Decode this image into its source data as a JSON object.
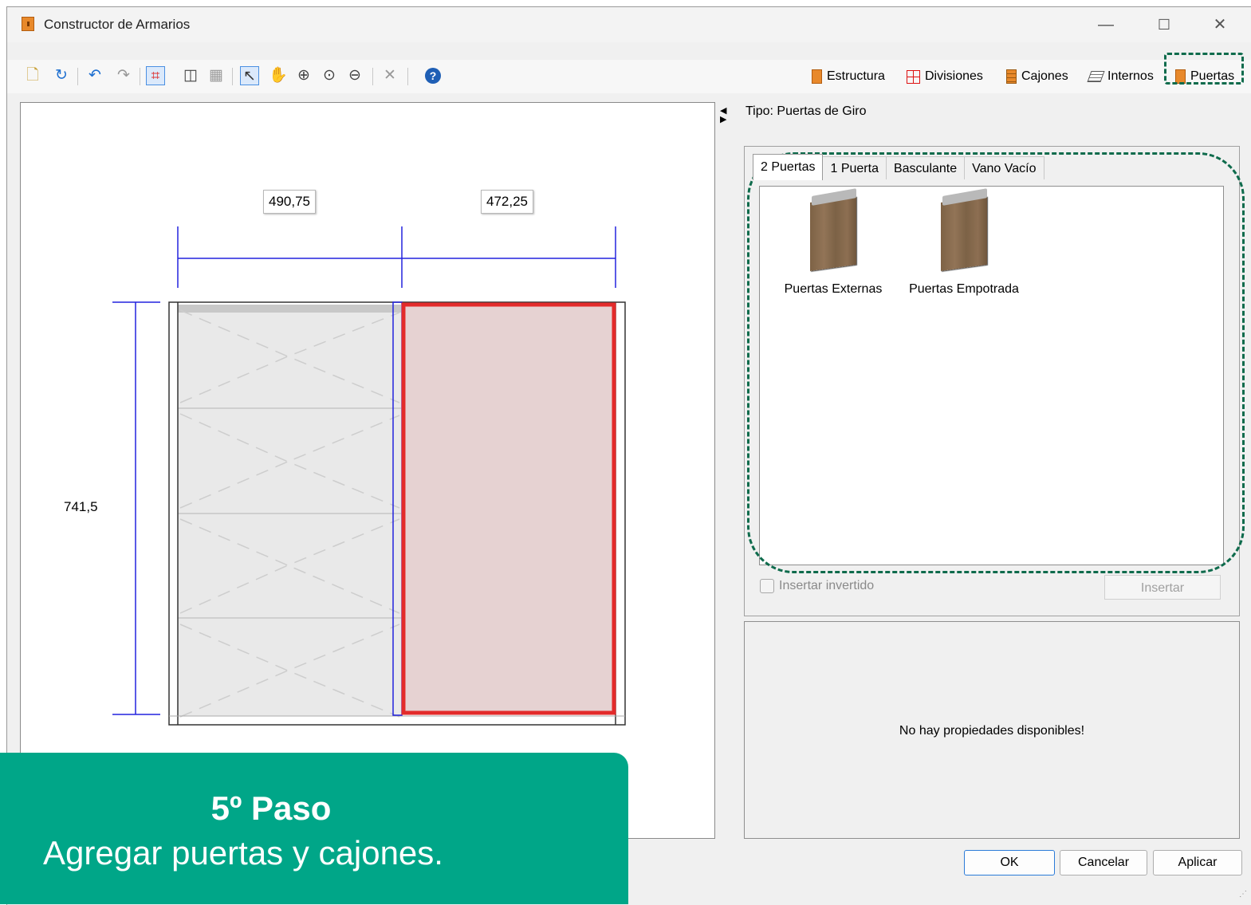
{
  "window": {
    "title": "Constructor de Armarios",
    "controls": {
      "minimize": "—",
      "maximize": "☐",
      "close": "✕"
    }
  },
  "toolbar": {
    "icons": [
      "new-icon",
      "refresh-icon",
      "undo-icon",
      "redo-icon",
      "show-dims-icon",
      "door-view-icon",
      "grid-icon",
      "pointer-icon",
      "pan-icon",
      "zoom-in-icon",
      "zoom-window-icon",
      "zoom-out-icon",
      "delete-icon",
      "help-icon"
    ],
    "modes": {
      "estructura": "Estructura",
      "divisiones": "Divisiones",
      "cajones": "Cajones",
      "internos": "Internos",
      "puertas": "Puertas"
    },
    "active_mode": "Puertas"
  },
  "drawing": {
    "dim_left": "490,75",
    "dim_right": "472,25",
    "dim_height": "741,5",
    "selected_color": "#e32b2b",
    "dim_color": "#2222dd"
  },
  "panel": {
    "tipo": "Tipo: Puertas de Giro",
    "tabs": [
      "2 Puertas",
      "1 Puerta",
      "Basculante",
      "Vano Vacío"
    ],
    "active_tab": "2 Puertas",
    "items": [
      {
        "label": "Puertas Externas",
        "icon": "door-wood-icon"
      },
      {
        "label": "Puertas Empotrada",
        "icon": "door-wood-icon"
      }
    ],
    "insert_inverted": "Insertar invertido",
    "insert_button": "Insertar",
    "properties_msg": "No hay propiedades disponibles!"
  },
  "dialog_buttons": {
    "ok": "OK",
    "cancel": "Cancelar",
    "apply": "Aplicar"
  },
  "overlay": {
    "step": "5º Paso",
    "description": "Agregar puertas y cajones.",
    "color": "#00a688"
  },
  "highlight_color": "#0e6b4c"
}
